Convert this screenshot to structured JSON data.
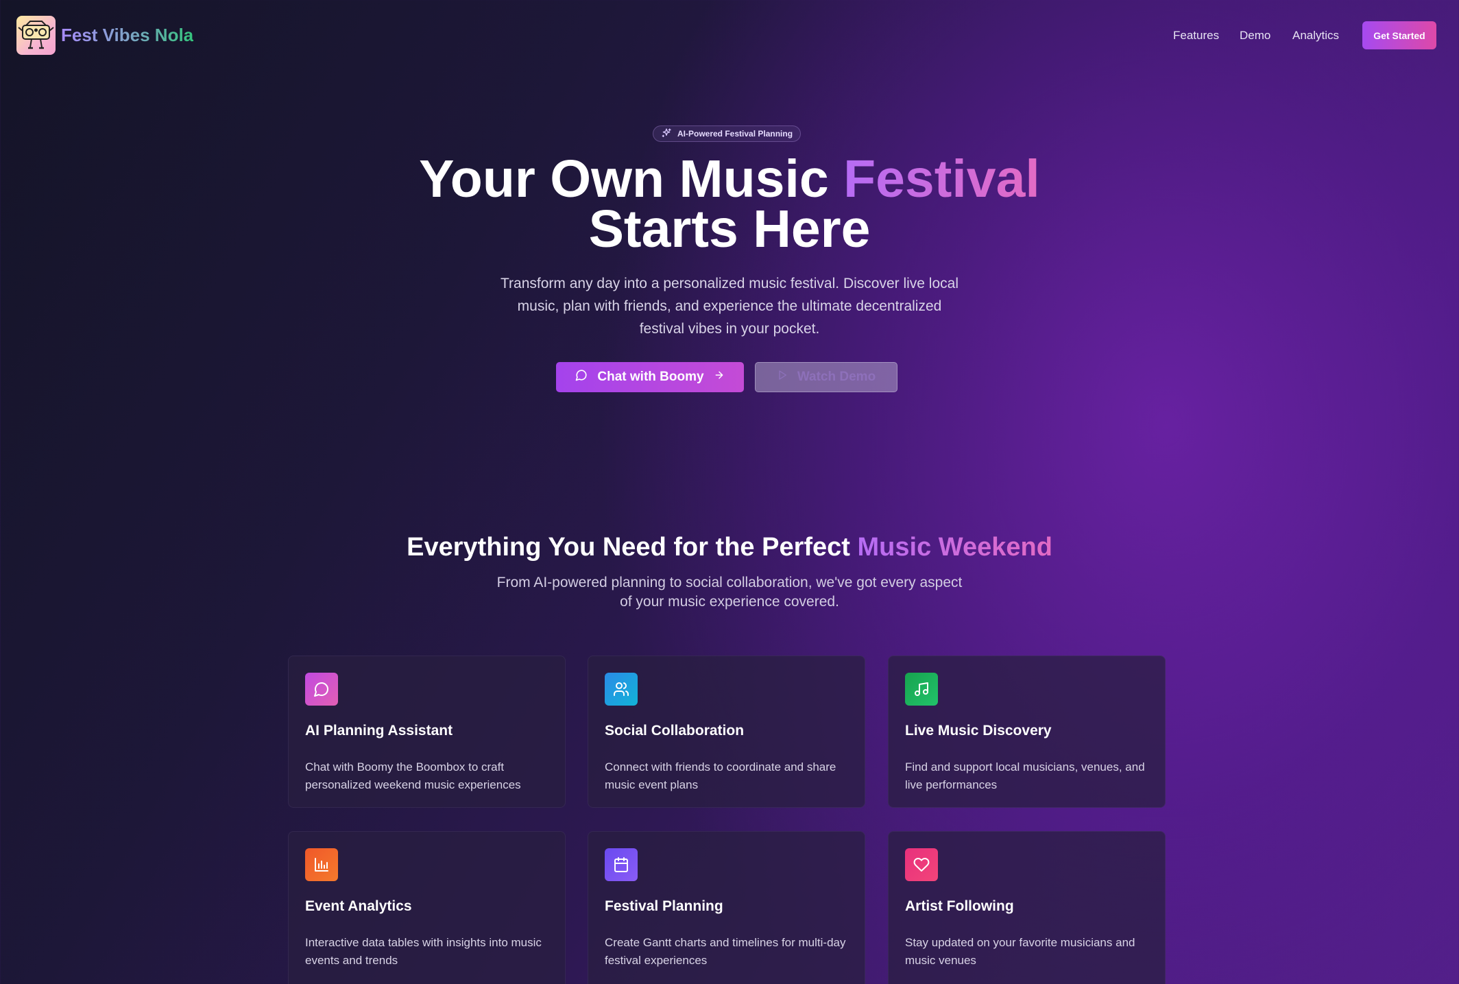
{
  "nav": {
    "brand": "Fest Vibes Nola",
    "links": [
      "Features",
      "Demo",
      "Analytics"
    ],
    "cta": "Get Started"
  },
  "hero": {
    "badge": "AI-Powered Festival Planning",
    "title_part1": "Your Own Music ",
    "title_highlight": "Festival",
    "title_line2": "Starts Here",
    "subtitle": "Transform any day into a personalized music festival. Discover live local music, plan with friends, and experience the ultimate decentralized festival vibes in your pocket.",
    "primary_button": "Chat with Boomy",
    "secondary_button": "Watch Demo"
  },
  "features": {
    "title_part1": "Everything You Need for the Perfect ",
    "title_highlight": "Music Weekend",
    "subtitle": "From AI-powered planning to social collaboration, we've got every aspect of your music experience covered.",
    "cards": [
      {
        "title": "AI Planning Assistant",
        "description": "Chat with Boomy the Boombox to craft personalized weekend music experiences",
        "icon": "chat-bubble-icon",
        "color_from": "#c14ae0",
        "color_to": "#e25fb4"
      },
      {
        "title": "Social Collaboration",
        "description": "Connect with friends to coordinate and share music event plans",
        "icon": "users-icon",
        "color_from": "#2a8be6",
        "color_to": "#12b3d8"
      },
      {
        "title": "Live Music Discovery",
        "description": "Find and support local musicians, venues, and live performances",
        "icon": "music-note-icon",
        "color_from": "#17a34f",
        "color_to": "#22c26a"
      },
      {
        "title": "Event Analytics",
        "description": "Interactive data tables with insights into music events and trends",
        "icon": "bar-chart-icon",
        "color_from": "#f0582a",
        "color_to": "#f47a2c"
      },
      {
        "title": "Festival Planning",
        "description": "Create Gantt charts and timelines for multi-day festival experiences",
        "icon": "calendar-icon",
        "color_from": "#6a4af0",
        "color_to": "#8a5cf5"
      },
      {
        "title": "Artist Following",
        "description": "Stay updated on your favorite musicians and music venues",
        "icon": "heart-icon",
        "color_from": "#e8307c",
        "color_to": "#f2457a"
      }
    ]
  }
}
